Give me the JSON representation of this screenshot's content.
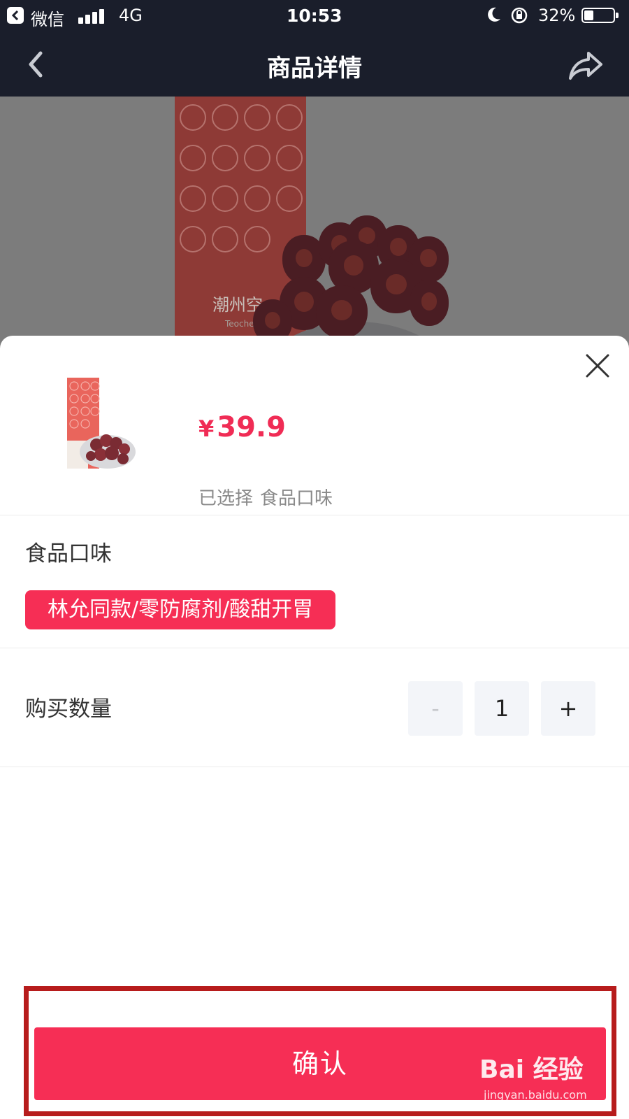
{
  "status_bar": {
    "carrier": "微信",
    "network": "4G",
    "time": "10:53",
    "battery": "32%",
    "battery_level": 0.32
  },
  "nav": {
    "title": "商品详情",
    "back_icon": "chevron-left-icon",
    "share_icon": "share-icon"
  },
  "hero": {
    "box_text": "潮州空",
    "box_subtext": "Teochew"
  },
  "product": {
    "currency": "¥",
    "price": "39.9",
    "selected_label": "已选择",
    "selected_value": "食品口味"
  },
  "options": {
    "label": "食品口味",
    "chip": "林允同款/零防腐剂/酸甜开胃"
  },
  "quantity": {
    "label": "购买数量",
    "minus": "-",
    "value": "1",
    "plus": "+"
  },
  "confirm": {
    "label": "确认"
  },
  "watermark": {
    "logo": "Bai 经验",
    "url": "jingyan.baidu.com"
  },
  "colors": {
    "accent": "#f62e55",
    "price": "#f02c55",
    "highlight_border": "#b71c1c",
    "nav_bg": "#1a1e2b"
  }
}
